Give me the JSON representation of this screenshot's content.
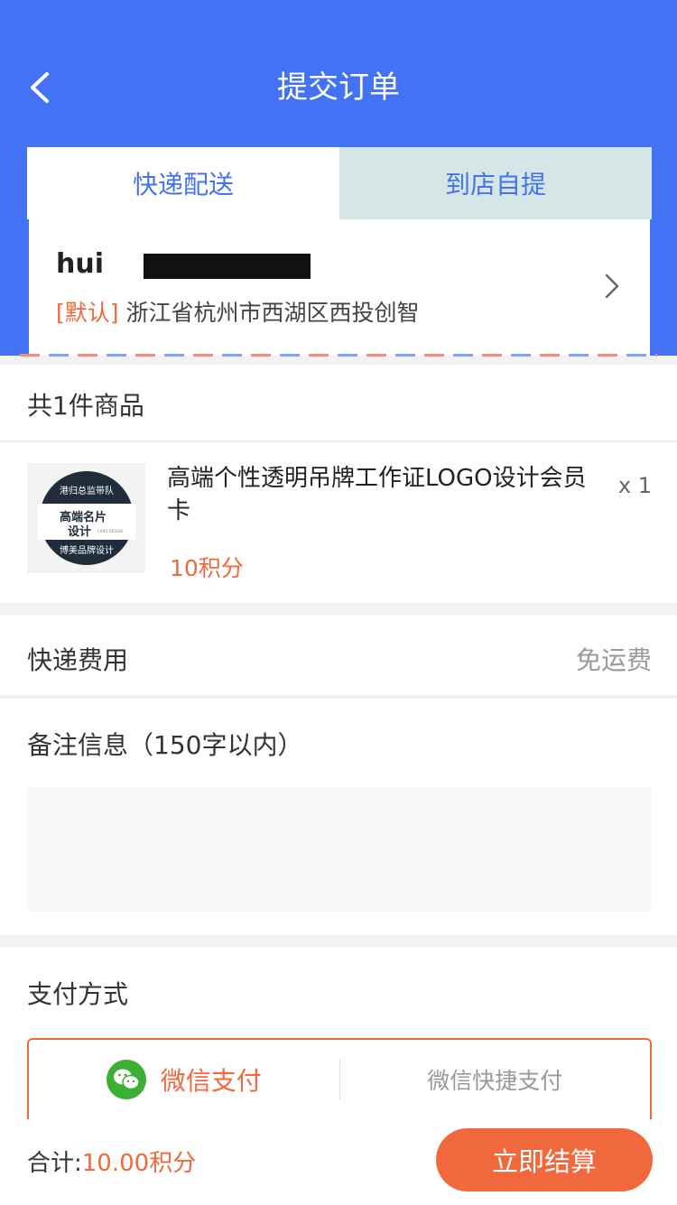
{
  "header": {
    "title": "提交订单",
    "back_icon": "chevron-left-icon"
  },
  "delivery_tabs": [
    {
      "label": "快递配送",
      "active": true
    },
    {
      "label": "到店自提",
      "active": false
    }
  ],
  "address": {
    "name": "hui",
    "default_tag": "[默认]",
    "line": "浙江省杭州市西湖区西投创智",
    "chevron_icon": "chevron-right-icon"
  },
  "order": {
    "count_label": "共1件商品",
    "product": {
      "name": "高端个性透明吊牌工作证LOGO设计会员卡",
      "price": "10积分",
      "quantity": "x 1",
      "thumb_text": {
        "top": "港归总监带队",
        "main_line1": "高端名片",
        "main_line2": "设计",
        "side": "CARD DESIGN",
        "bottom": "博美品牌设计"
      }
    }
  },
  "shipping": {
    "label": "快递费用",
    "value": "免运费"
  },
  "remark": {
    "label": "备注信息（150字以内）",
    "value": ""
  },
  "payment": {
    "label": "支付方式",
    "options": [
      {
        "label": "微信支付",
        "icon": "wechat-icon",
        "selected": true
      },
      {
        "label": "微信快捷支付",
        "selected": false
      }
    ]
  },
  "footer": {
    "total_label": "合计:",
    "total_value": "10.00积分",
    "checkout_label": "立即结算"
  },
  "colors": {
    "primary": "#4472f5",
    "accent": "#f0683c",
    "wechat": "#3cb035"
  }
}
